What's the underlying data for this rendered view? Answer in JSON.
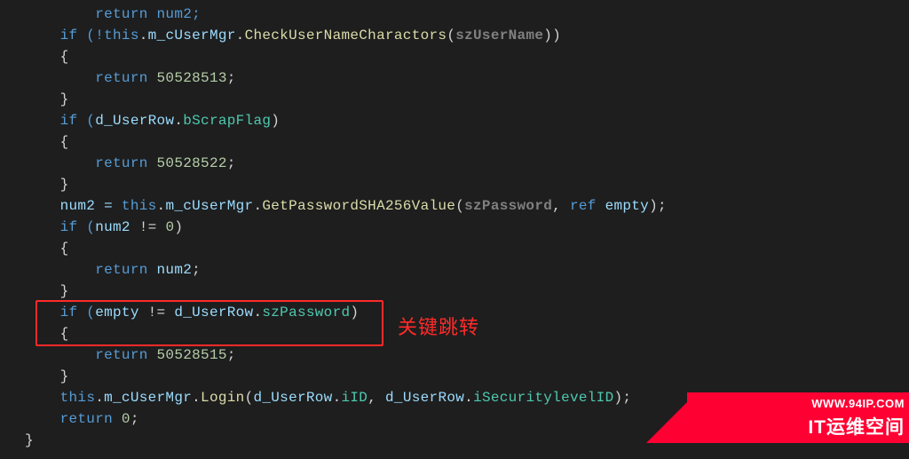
{
  "code": {
    "l1": "        return num2;",
    "l2_pre": "    if (!",
    "l2_this": "this",
    "l2_dot1": ".",
    "l2_mem1": "m_cUserMgr",
    "l2_dot2": ".",
    "l2_meth": "CheckUserNameCharactors",
    "l2_open": "(",
    "l2_arg": "szUserName",
    "l2_close": "))",
    "l3": "    {",
    "l4_pre": "        return ",
    "l4_val": "50528513",
    "l4_end": ";",
    "l5": "    }",
    "l6_pre": "    if (",
    "l6_id": "d_UserRow",
    "l6_dot": ".",
    "l6_mem": "bScrapFlag",
    "l6_end": ")",
    "l7": "    {",
    "l8_pre": "        return ",
    "l8_val": "50528522",
    "l8_end": ";",
    "l9": "    }",
    "l10_lhs": "    num2 = ",
    "l10_this": "this",
    "l10_d1": ".",
    "l10_m1": "m_cUserMgr",
    "l10_d2": ".",
    "l10_meth": "GetPasswordSHA256Value",
    "l10_open": "(",
    "l10_a1": "szPassword",
    "l10_c": ", ",
    "l10_ref": "ref",
    "l10_sp": " ",
    "l10_a2": "empty",
    "l10_close": ");",
    "l11_pre": "    if (",
    "l11_id": "num2",
    "l11_op": " != ",
    "l11_zero": "0",
    "l11_end": ")",
    "l12": "    {",
    "l13_pre": "        return ",
    "l13_id": "num2",
    "l13_end": ";",
    "l14": "    }",
    "l15_pre": "    if (",
    "l15_a": "empty",
    "l15_op": " != ",
    "l15_b": "d_UserRow",
    "l15_dot": ".",
    "l15_mem": "szPassword",
    "l15_end": ")",
    "l16": "    {",
    "l17_pre": "        return ",
    "l17_val": "50528515",
    "l17_end": ";",
    "l18": "    }",
    "l19_pre": "    ",
    "l19_this": "this",
    "l19_d1": ".",
    "l19_m1": "m_cUserMgr",
    "l19_d2": ".",
    "l19_meth": "Login",
    "l19_open": "(",
    "l19_a1": "d_UserRow",
    "l19_d3": ".",
    "l19_p1": "iID",
    "l19_c": ", ",
    "l19_a2": "d_UserRow",
    "l19_d4": ".",
    "l19_p2": "iSecuritylevelID",
    "l19_close": ");",
    "l20_pre": "    return ",
    "l20_val": "0",
    "l20_end": ";",
    "l21": "}"
  },
  "annotation": "关键跳转",
  "watermark": {
    "url": "WWW.94IP.COM",
    "brand": "IT运维空间"
  }
}
